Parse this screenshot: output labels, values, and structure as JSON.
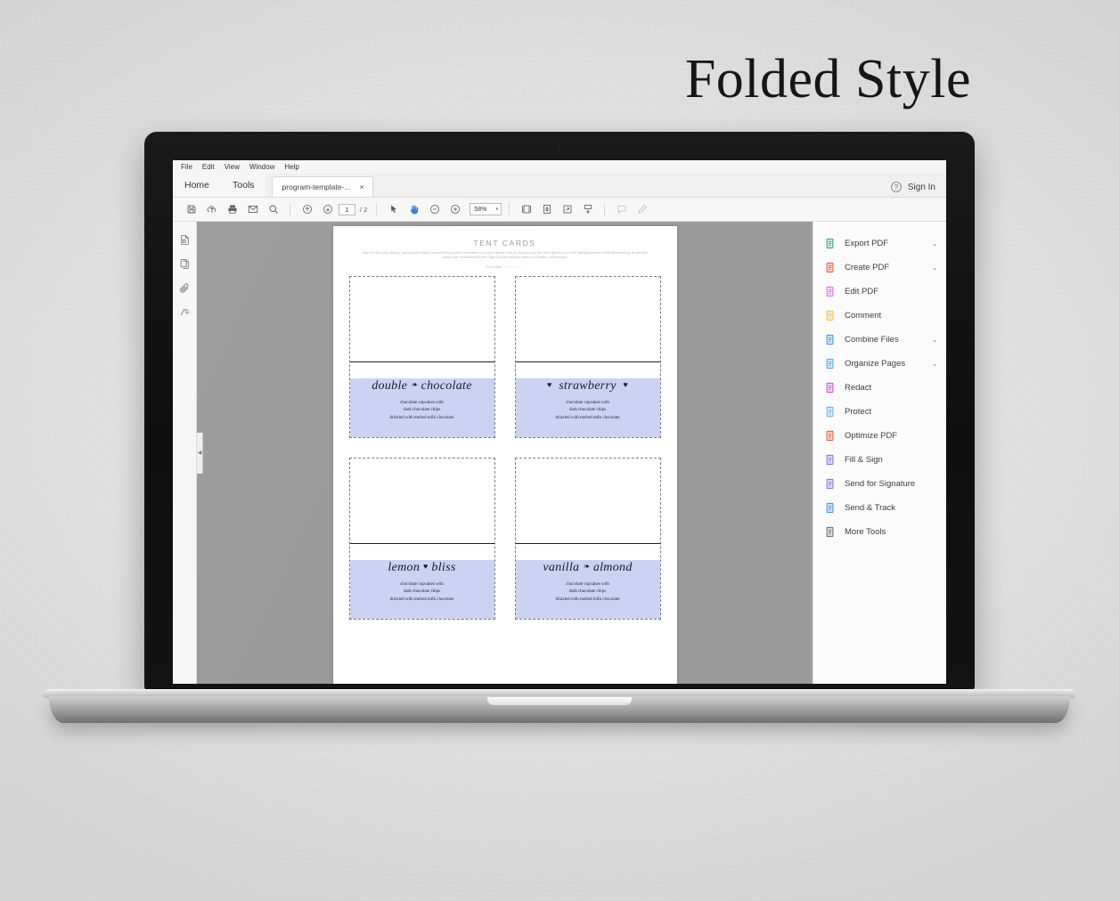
{
  "title": "Folded Style",
  "app": {
    "menubar": [
      "File",
      "Edit",
      "View",
      "Window",
      "Help"
    ],
    "tabs": {
      "home": "Home",
      "tools": "Tools",
      "document": "program-template-...",
      "close_glyph": "×"
    },
    "account": {
      "help_icon": "help-circle-icon",
      "sign_in": "Sign In"
    },
    "toolbar": {
      "save_icon": "save-icon",
      "upload_icon": "upload-cloud-icon",
      "print_icon": "print-icon",
      "email_icon": "email-icon",
      "search_icon": "search-icon",
      "prev_page_icon": "arrow-up-circle-icon",
      "next_page_icon": "arrow-down-circle-icon",
      "page_current": "1",
      "page_total": "/ 2",
      "select_icon": "cursor-arrow-icon",
      "hand_icon": "hand-tool-icon",
      "zoom_out_icon": "zoom-out-icon",
      "zoom_in_icon": "zoom-in-icon",
      "zoom_value": "58%",
      "zoom_caret": "▾",
      "fit_width_icon": "fit-width-icon",
      "fit_page_icon": "fit-page-icon",
      "fullscreen_icon": "fullscreen-icon",
      "scroll_mode_icon": "scroll-mode-icon",
      "comment_icon": "comment-icon",
      "highlight_icon": "highlight-pen-icon"
    },
    "navpane": [
      {
        "icon": "page-thumbnails-icon",
        "name": "page-thumbnails"
      },
      {
        "icon": "pages-icon",
        "name": "pages"
      },
      {
        "icon": "attachment-clip-icon",
        "name": "attachments"
      },
      {
        "icon": "signature-icon",
        "name": "signatures"
      }
    ],
    "collapse_handle_glyph": "◀",
    "tools_panel": [
      {
        "label": "Export PDF",
        "icon": "export-pdf-icon",
        "color": "#2f9e7e",
        "caret": "⌄"
      },
      {
        "label": "Create PDF",
        "icon": "create-pdf-icon",
        "color": "#e5533d",
        "caret": "⌄"
      },
      {
        "label": "Edit PDF",
        "icon": "edit-pdf-icon",
        "color": "#d96fd0",
        "caret": ""
      },
      {
        "label": "Comment",
        "icon": "comment-bubble-icon",
        "color": "#f0c040",
        "caret": ""
      },
      {
        "label": "Combine Files",
        "icon": "combine-files-icon",
        "color": "#3f8fd6",
        "caret": "⌄"
      },
      {
        "label": "Organize Pages",
        "icon": "organize-pages-icon",
        "color": "#3fa9d6",
        "caret": "⌄"
      },
      {
        "label": "Redact",
        "icon": "redact-marker-icon",
        "color": "#c94fb5",
        "caret": ""
      },
      {
        "label": "Protect",
        "icon": "shield-icon",
        "color": "#6aa8dd",
        "caret": ""
      },
      {
        "label": "Optimize PDF",
        "icon": "optimize-pdf-icon",
        "color": "#e5533d",
        "caret": ""
      },
      {
        "label": "Fill & Sign",
        "icon": "fill-and-sign-icon",
        "color": "#7a6fd8",
        "caret": ""
      },
      {
        "label": "Send for Signature",
        "icon": "send-for-signature-icon",
        "color": "#7a6fd8",
        "caret": ""
      },
      {
        "label": "Send & Track",
        "icon": "send-and-track-icon",
        "color": "#3f8fd6",
        "caret": ""
      },
      {
        "label": "More Tools",
        "icon": "plus-circle-icon",
        "color": "#6a6a6a",
        "caret": ""
      }
    ]
  },
  "document": {
    "heading": "TENT CARDS",
    "instructions": "Save the file to your desktop, open Acrobat Reader (available at get.adobe.com/reader) if you don't already have it), and open your file.  Click right into one of the highlighted areas to edit! When printing, be sure that “Actual Size” is selected from the “Page Size and Handling” section of Reader's print dialogue.",
    "font_guide": "Font Guide:  ˇ = ˇ  | = ⌣  _ = ⌣",
    "description_lines": [
      "chocolate cupcakes with",
      "dark chocolate chips",
      "drizzled with melted milk chocolate"
    ],
    "cards": [
      {
        "flavor_before": "double",
        "heart": "❧",
        "flavor_after": "chocolate",
        "hearts_outside": false
      },
      {
        "flavor_before": "",
        "heart": "♥",
        "flavor_after": "strawberry",
        "hearts_outside": true
      },
      {
        "flavor_before": "lemon",
        "heart": "♥",
        "flavor_after": "bliss",
        "hearts_outside": false
      },
      {
        "flavor_before": "vanilla",
        "heart": "❧",
        "flavor_after": "almond",
        "hearts_outside": false
      }
    ],
    "highlight_color": "#ccd2f2"
  }
}
